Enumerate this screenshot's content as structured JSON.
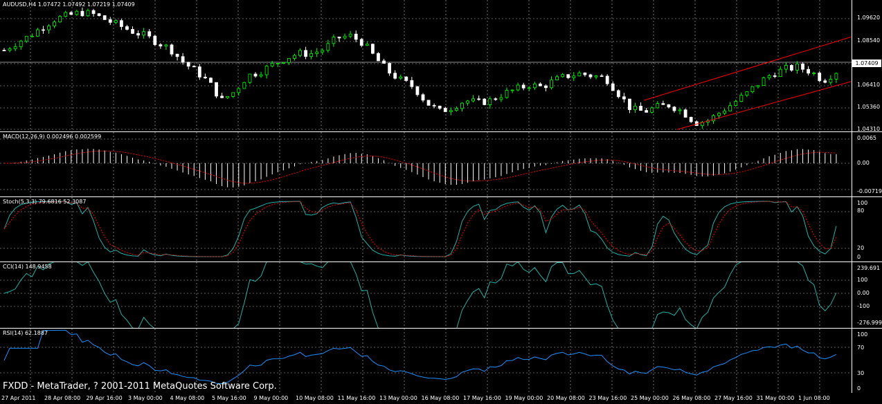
{
  "window": {
    "watermark": "FXDD - MetaTrader, ? 2001-2011 MetaQuotes Software Corp."
  },
  "colors": {
    "background": "#000000",
    "bull_candle": "#00ff00",
    "bear_candle": "#ffffff",
    "grid": "#c0c0c0",
    "channel": "#ff0000",
    "macd_hist": "#ffffff",
    "macd_signal": "#ff0000",
    "stoch_main": "#20b2aa",
    "stoch_signal": "#ff0000",
    "cci": "#20b2aa",
    "rsi": "#1e90ff"
  },
  "main_chart": {
    "label": "AUDUSD,H4  1.07472 1.07492 1.07219 1.07409",
    "price_levels": [
      "1.09620",
      "1.08540",
      "1.07409",
      "1.06410",
      "1.05360",
      "1.04310"
    ],
    "current_price": "1.07409"
  },
  "macd": {
    "label": "MACD(12,26,9) 0.002496 0.002599",
    "levels": [
      "0.0065",
      "0.00",
      "-0.00719"
    ]
  },
  "stoch": {
    "label": "Stoch(5,3,3) 79.6816 52.3087",
    "levels": [
      "100",
      "80",
      "20",
      "0"
    ]
  },
  "cci": {
    "label": "CCI(14) 148.9458",
    "levels": [
      "239.691",
      "100",
      "0.00",
      "-100",
      "-276.999"
    ]
  },
  "rsi": {
    "label": "RSI(14) 62.1887",
    "levels": [
      "100",
      "70",
      "30",
      "0"
    ]
  },
  "time_axis": [
    "27 Apr 2011",
    "28 Apr 08:00",
    "29 Apr 16:00",
    "3 May 00:00",
    "4 May 08:00",
    "5 May 16:00",
    "9 May 00:00",
    "10 May 08:00",
    "11 May 16:00",
    "13 May 00:00",
    "16 May 08:00",
    "17 May 16:00",
    "19 May 00:00",
    "20 May 08:00",
    "23 May 16:00",
    "25 May 00:00",
    "26 May 08:00",
    "27 May 16:00",
    "31 May 00:00",
    "1 Jun 08:00"
  ],
  "chart_data": {
    "type": "candlestick",
    "symbol": "AUDUSD",
    "timeframe": "H4",
    "ohlc_last": {
      "open": 1.07472,
      "high": 1.07492,
      "low": 1.07219,
      "close": 1.07409
    },
    "ylim": [
      1.0431,
      1.102
    ],
    "close_path": [
      1.0795,
      1.083,
      1.086,
      1.09,
      1.0935,
      1.095,
      1.0965,
      1.0955,
      1.093,
      1.0905,
      1.088,
      1.086,
      1.083,
      1.08,
      1.074,
      1.07,
      1.065,
      1.057,
      1.061,
      1.068,
      1.07,
      1.073,
      1.076,
      1.078,
      1.078,
      1.08,
      1.085,
      1.086,
      1.083,
      1.076,
      1.07,
      1.066,
      1.063,
      1.056,
      1.052,
      1.054,
      1.057,
      1.056,
      1.057,
      1.06,
      1.062,
      1.064,
      1.063,
      1.066,
      1.068,
      1.069,
      1.068,
      1.067,
      1.06,
      1.053,
      1.052,
      1.054,
      1.055,
      1.052,
      1.047,
      1.048,
      1.052,
      1.056,
      1.06,
      1.065,
      1.069,
      1.071,
      1.072,
      1.07,
      1.066,
      1.07
    ],
    "channel": {
      "start": {
        "x": "23 May 16:00",
        "y": 1.057
      },
      "end": {
        "x": "1 Jun 08:00",
        "y": 1.0855
      },
      "lower_start": 1.044,
      "lower_end": 1.0655
    }
  }
}
